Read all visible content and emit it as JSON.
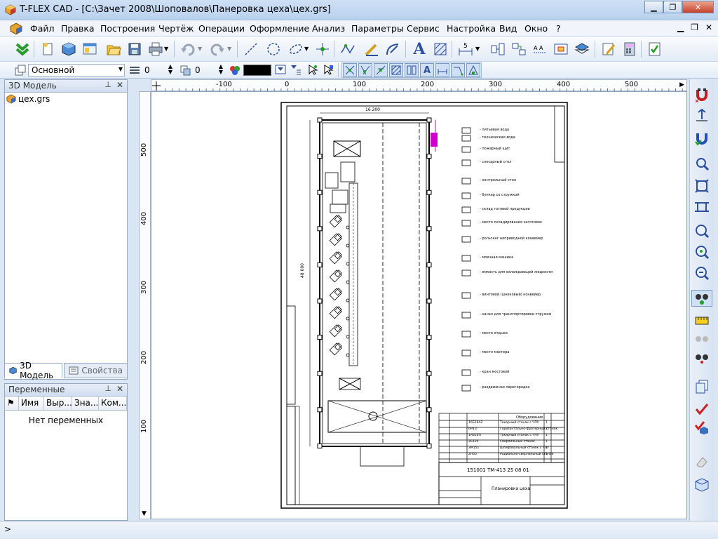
{
  "window": {
    "title": "T-FLEX CAD - [C:\\Зачет 2008\\Шоповалов\\Панеровка цеха\\цех.grs]"
  },
  "menu": [
    "Файл",
    "Правка",
    "Построения",
    "Чертёж",
    "Операции",
    "Оформление",
    "Анализ",
    "Параметры",
    "Сервис",
    "Настройка",
    "Вид",
    "Окно",
    "?"
  ],
  "toolbar2": {
    "layer": "Основной",
    "level_value": "0",
    "priority_value": "0"
  },
  "left_panel": {
    "model_title": "3D Модель",
    "tree_item": "цех.grs",
    "tab_model": "3D Модель",
    "tab_props": "Свойства"
  },
  "vars_panel": {
    "title": "Переменные",
    "columns": [
      "Имя",
      "Выр...",
      "Зна...",
      "Ком..."
    ],
    "empty_text": "Нет переменных"
  },
  "ruler_h": {
    "ticks": [
      "-100",
      "0",
      "100",
      "200",
      "300",
      "400",
      "500"
    ]
  },
  "ruler_v": {
    "ticks": [
      "500",
      "400",
      "300",
      "200",
      "100"
    ]
  },
  "drawing": {
    "top_dim": "16 200",
    "side_dim": "48 000",
    "doc_code": "151001 ТМ-413 25 08 01",
    "doc_title": "Планировка цеха",
    "legend": [
      "- питьевая вода",
      "- техническая вода",
      "- пожарный щит",
      "- слесарный стол",
      "- контрольный стол",
      "- бункер со стружкой",
      "- склад готовой продукции",
      "- место складирования заготовок",
      "- рольганг неприводной конвейер",
      "- моечная машина",
      "- емкость для охлаждающей жидкости",
      "- винтовой (шнековый) конвейер",
      "- канал для транспортировки стружки",
      "- место отдыха",
      "- место мастера",
      "- кран мостовой",
      "- раздвижная перегородка"
    ],
    "bom_header": [
      "Обозначение",
      "Наименование",
      "Кол."
    ],
    "bom_title": "Оборудование",
    "bom_rows": [
      [
        "16Б16А2",
        "Токарный станок с ЧПУ",
        "1"
      ],
      [
        "6Р81Г",
        "Горизонтально-фрезерный станок",
        "1"
      ],
      [
        "1А616П",
        "Токарный станок с ЧПУ",
        "1"
      ],
      [
        "2Б125",
        "Сверлильный станок",
        "1"
      ],
      [
        "3М151",
        "Шлифовальный станок с ЧПУ",
        "1"
      ],
      [
        "2Н55",
        "Радиально-сверлильный станок",
        "1"
      ]
    ]
  },
  "colors": {
    "accent": "#cc00cc",
    "title_bg": "#c3d6ef"
  }
}
